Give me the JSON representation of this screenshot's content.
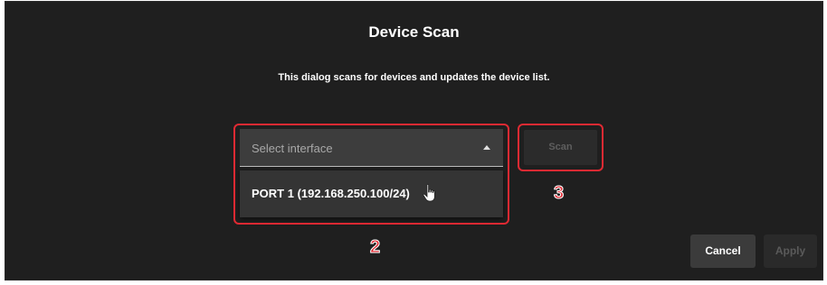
{
  "dialog": {
    "title": "Device Scan",
    "description": "This dialog scans for devices and updates the device list."
  },
  "interface_select": {
    "placeholder": "Select interface",
    "options": [
      "PORT 1 (192.168.250.100/24)"
    ]
  },
  "buttons": {
    "scan_label": "Scan",
    "cancel_label": "Cancel",
    "apply_label": "Apply",
    "scan_enabled": false,
    "apply_enabled": false
  },
  "annotations": {
    "callout_2": "2",
    "callout_3": "3",
    "highlight_color": "#e02a33"
  },
  "icons": {
    "caret": "caret-up-icon",
    "cursor": "hand-pointer-icon"
  },
  "colors": {
    "dialog_background": "#1f1f1f",
    "text": "#ffffff"
  }
}
